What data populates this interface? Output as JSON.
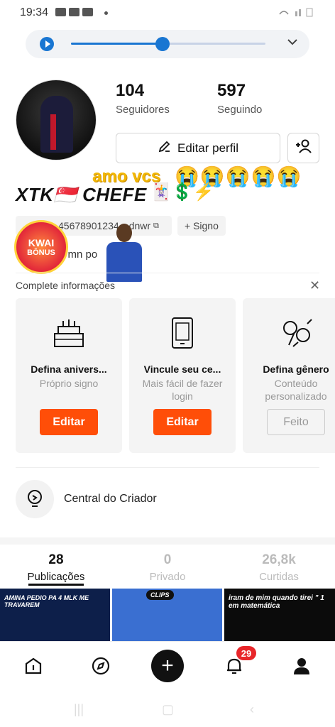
{
  "status_bar": {
    "time": "19:34"
  },
  "player": {
    "progress": 0.47
  },
  "profile": {
    "followers_count": "104",
    "followers_label": "Seguidores",
    "following_count": "597",
    "following_label": "Seguindo",
    "edit_label": "Editar perfil",
    "overlay_text": "amo vcs",
    "overlay_emojis": "😭😭😭😭😭",
    "username": "XTK🇸🇬 CHEFE",
    "name_badges": "🃏💲⚡",
    "id_text": "45678901234",
    "id_suffix": "dnwr",
    "sign_label": "+ Signo",
    "bio": "i mn po"
  },
  "kwai_bonus": {
    "line1": "KWAI",
    "line2": "BÔNUS"
  },
  "complete_info": {
    "title": "Complete informações",
    "cards": [
      {
        "icon": "cake-icon",
        "title": "Defina anivers...",
        "subtitle": "Próprio signo",
        "button": "Editar"
      },
      {
        "icon": "phone-icon",
        "title": "Vincule seu ce...",
        "subtitle": "Mais fácil de fazer  login",
        "button": "Editar"
      },
      {
        "icon": "gender-icon",
        "title": "Defina gênero",
        "subtitle": "Conteúdo personalizado",
        "button": "Feito"
      }
    ]
  },
  "creator_center": {
    "label": "Central do Criador"
  },
  "tabs": [
    {
      "count": "28",
      "label": "Publicações"
    },
    {
      "count": "0",
      "label": "Privado"
    },
    {
      "count": "26,8k",
      "label": "Curtidas"
    }
  ],
  "thumbnails": [
    {
      "caption": "AMINA PEDIO PA 4 MLK ME TRAVAREM",
      "color": "#0d1f4a"
    },
    {
      "caption": "CLIPS",
      "color": "#3a6fd1"
    },
    {
      "caption": "iram de mim quando tirei \" 1 em matemática",
      "color": "#0b0b0b"
    }
  ],
  "bottom_nav": {
    "notification_count": "29"
  },
  "colors": {
    "accent": "#ff4e08",
    "link": "#1976d2",
    "badge": "#e8262a"
  }
}
